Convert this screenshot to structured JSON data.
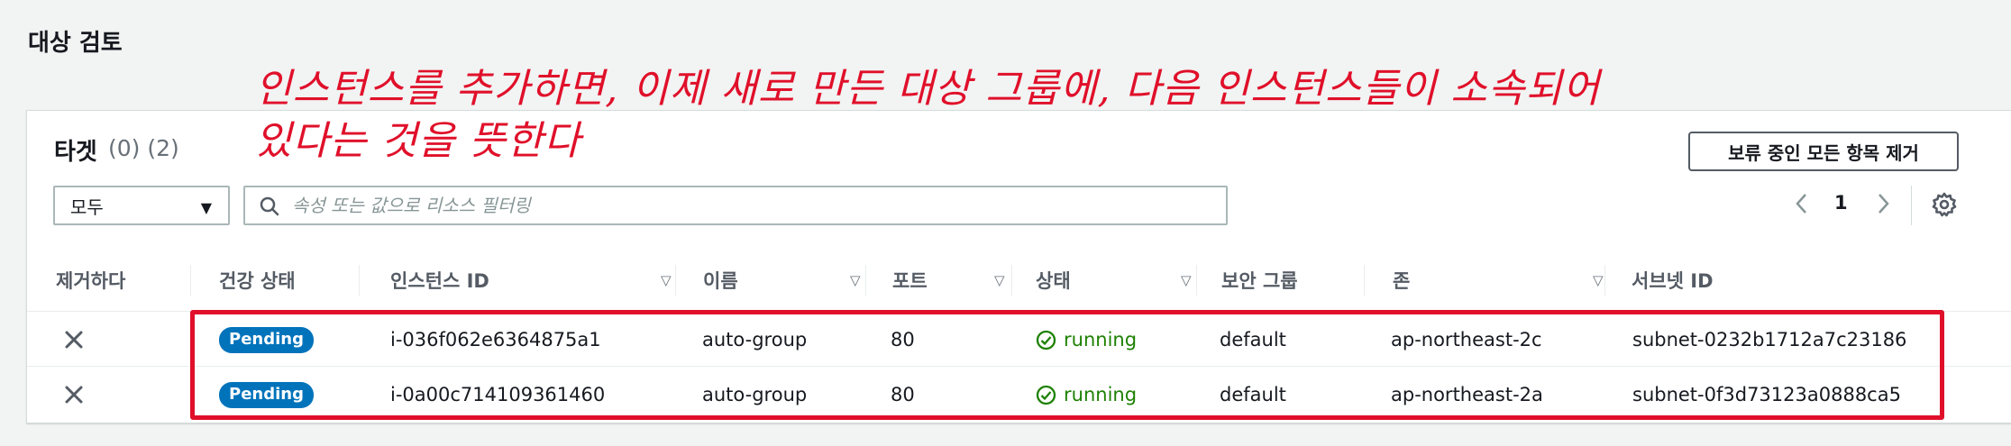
{
  "page": {
    "title": "대상 검토"
  },
  "annotation": {
    "text": "인스턴스를 추가하면, 이제 새로 만든 대상 그룹에, 다음 인스턴스들이 소속되어\n있다는 것을 뜻한다"
  },
  "targets": {
    "title": "타겟",
    "count": "(0) (2)",
    "remove_all_label": "보류 중인 모든 항목 제거",
    "filter_value": "모두",
    "search_placeholder": "속성 또는 값으로 리소스 필터링",
    "page_number": "1"
  },
  "columns": [
    "제거하다",
    "건강 상태",
    "인스턴스 ID",
    "이름",
    "포트",
    "상태",
    "보안 그룹",
    "존",
    "서브넷 ID"
  ],
  "rows": [
    {
      "health": "Pending",
      "instance_id": "i-036f062e6364875a1",
      "name": "auto-group",
      "port": "80",
      "state": "running",
      "security_group": "default",
      "zone": "ap-northeast-2c",
      "subnet": "subnet-0232b1712a7c23186"
    },
    {
      "health": "Pending",
      "instance_id": "i-0a00c714109361460",
      "name": "auto-group",
      "port": "80",
      "state": "running",
      "security_group": "default",
      "zone": "ap-northeast-2a",
      "subnet": "subnet-0f3d73123a0888ca5"
    }
  ],
  "colors": {
    "annotation": "#e0102a",
    "pending_badge": "#0073bb",
    "running": "#1d8102"
  },
  "icons": [
    "search-icon",
    "caret-down-icon",
    "chevron-left-icon",
    "chevron-right-icon",
    "gear-icon",
    "sort-icon",
    "close-icon",
    "check-circle-icon"
  ]
}
